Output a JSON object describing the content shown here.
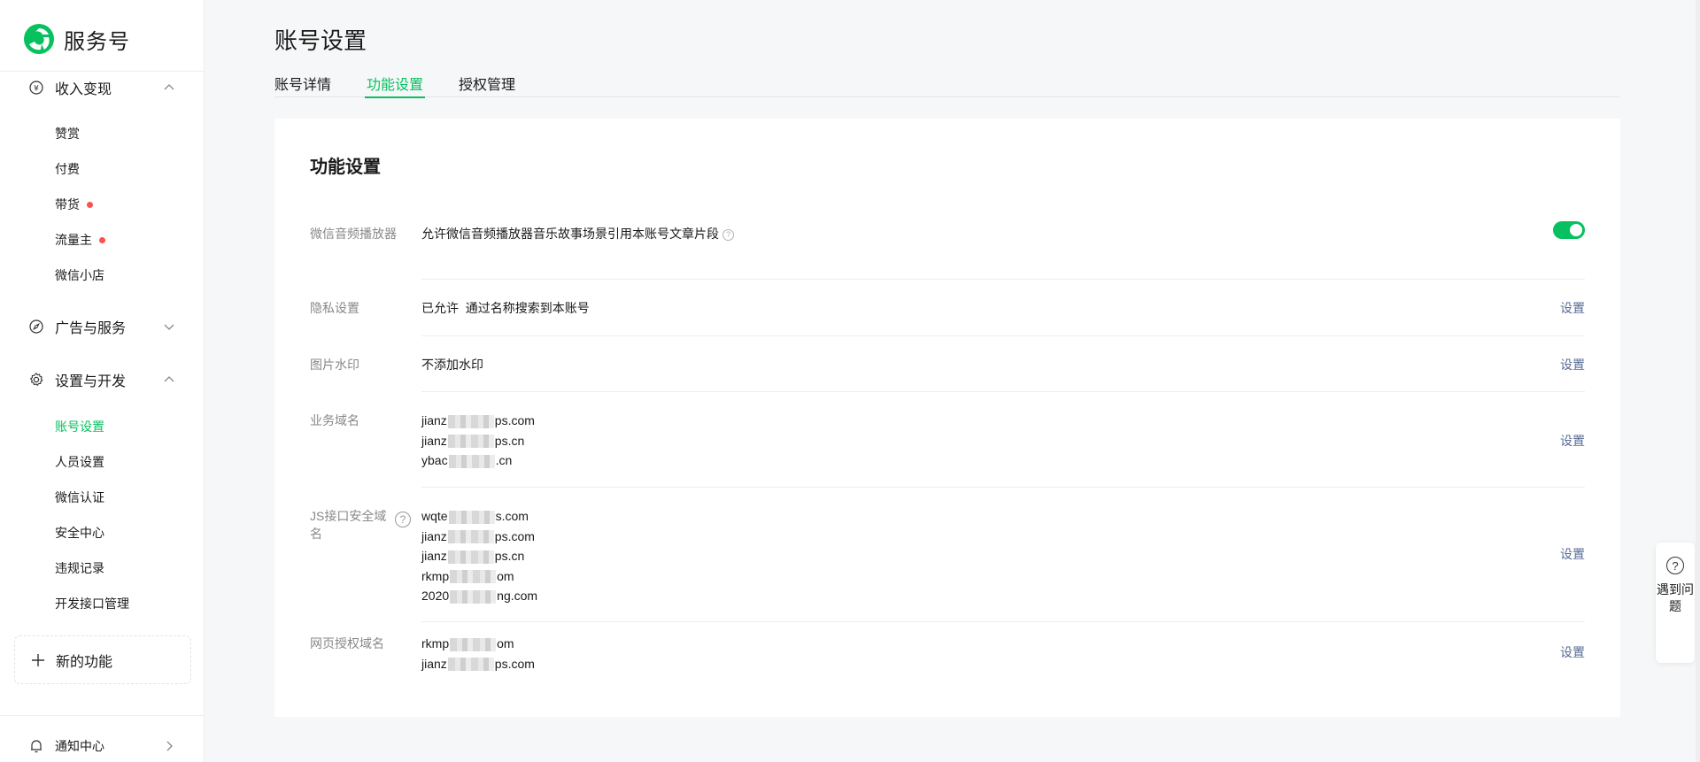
{
  "brand": {
    "name": "服务号",
    "logo": "wechat-service-logo"
  },
  "sidebar": {
    "groups": [
      {
        "label": "收入变现",
        "icon": "yen-icon",
        "expanded": true,
        "items": [
          {
            "label": "赞赏",
            "dot": false
          },
          {
            "label": "付费",
            "dot": false
          },
          {
            "label": "带货",
            "dot": true
          },
          {
            "label": "流量主",
            "dot": true
          },
          {
            "label": "微信小店",
            "dot": false
          }
        ]
      },
      {
        "label": "广告与服务",
        "icon": "compass-icon",
        "expanded": false,
        "items": []
      },
      {
        "label": "设置与开发",
        "icon": "gear-icon",
        "expanded": true,
        "items": [
          {
            "label": "账号设置",
            "active": true
          },
          {
            "label": "人员设置"
          },
          {
            "label": "微信认证"
          },
          {
            "label": "安全中心"
          },
          {
            "label": "违规记录"
          },
          {
            "label": "开发接口管理"
          }
        ]
      }
    ],
    "new_feature_label": "新的功能",
    "notice_label": "通知中心"
  },
  "header": {
    "title": "账号设置",
    "tabs": [
      {
        "label": "账号详情",
        "active": false
      },
      {
        "label": "功能设置",
        "active": true
      },
      {
        "label": "授权管理",
        "active": false
      }
    ]
  },
  "card": {
    "title": "功能设置",
    "rows": [
      {
        "label": "微信音频播放器",
        "value": "允许微信音频播放器音乐故事场景引用本账号文章片段",
        "control": "toggle",
        "on": true
      },
      {
        "label": "隐私设置",
        "value": "已允许  通过名称搜索到本账号",
        "action": "设置"
      },
      {
        "label": "图片水印",
        "value": "不添加水印",
        "action": "设置"
      },
      {
        "label": "业务域名",
        "domains": [
          {
            "pre": "jianz",
            "post": "ps.com"
          },
          {
            "pre": "jianz",
            "post": "ps.cn"
          },
          {
            "pre": "ybac",
            "post": ".cn"
          }
        ],
        "action": "设置"
      },
      {
        "label": "JS接口安全域名",
        "domains": [
          {
            "pre": "wqte",
            "post": "s.com"
          },
          {
            "pre": "jianz",
            "post": "ps.com"
          },
          {
            "pre": "jianz",
            "post": "ps.cn"
          },
          {
            "pre": "rkmp",
            "post": "om"
          },
          {
            "pre": "2020",
            "post": "ng.com"
          }
        ],
        "action": "设置"
      },
      {
        "label": "网页授权域名",
        "domains": [
          {
            "pre": "rkmp",
            "post": "om"
          },
          {
            "pre": "jianz",
            "post": "ps.com"
          }
        ],
        "action": "设置"
      }
    ]
  },
  "help": {
    "label": "遇到问题",
    "icon": "question-circle-icon"
  },
  "colors": {
    "accent": "#07c160",
    "link": "#576b95",
    "dot": "#fa5151"
  }
}
